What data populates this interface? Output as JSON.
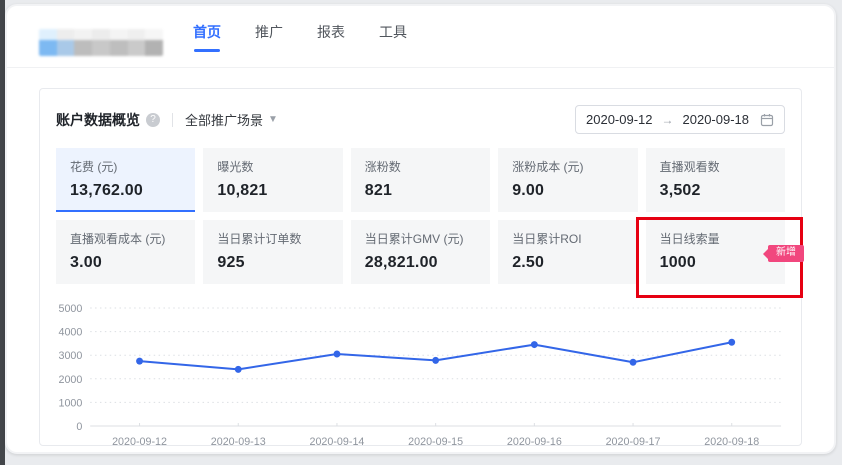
{
  "nav": {
    "tabs": [
      {
        "label": "首页",
        "active": true
      },
      {
        "label": "推广",
        "active": false
      },
      {
        "label": "报表",
        "active": false
      },
      {
        "label": "工具",
        "active": false
      }
    ]
  },
  "panel": {
    "title": "账户数据概览",
    "help_icon": "question-mark",
    "scene_filter": "全部推广场景",
    "date_start": "2020-09-12",
    "date_arrow": "→",
    "date_end": "2020-09-18"
  },
  "stats": [
    {
      "label": "花费 (元)",
      "value": "13,762.00",
      "selected": true
    },
    {
      "label": "曝光数",
      "value": "10,821"
    },
    {
      "label": "涨粉数",
      "value": "821"
    },
    {
      "label": "涨粉成本 (元)",
      "value": "9.00"
    },
    {
      "label": "直播观看数",
      "value": "3,502"
    },
    {
      "label": "直播观看成本 (元)",
      "value": "3.00"
    },
    {
      "label": "当日累计订单数",
      "value": "925"
    },
    {
      "label": "当日累计GMV (元)",
      "value": "28,821.00"
    },
    {
      "label": "当日累计ROI",
      "value": "2.50"
    },
    {
      "label": "当日线索量",
      "value": "1000",
      "badge": "新增",
      "annotated": true
    }
  ],
  "chart_data": {
    "type": "line",
    "x": [
      "2020-09-12",
      "2020-09-13",
      "2020-09-14",
      "2020-09-15",
      "2020-09-16",
      "2020-09-17",
      "2020-09-18"
    ],
    "series": [
      {
        "name": "花费",
        "values": [
          2750,
          2400,
          3050,
          2780,
          3450,
          2700,
          3550
        ]
      }
    ],
    "ylim": [
      0,
      5000
    ],
    "yticks": [
      0,
      1000,
      2000,
      3000,
      4000,
      5000
    ],
    "grid": "dotted horizontal",
    "legend": "none",
    "line_color": "#3366e8",
    "axis_color": "#dcdfe3",
    "tick_label_color": "#8f959e"
  },
  "colors": {
    "accent": "#3370ff",
    "badge_pink": "#f1477e",
    "annotation_red": "#e60012",
    "selected_card_bg": "#edf3fe",
    "card_bg": "#f5f6f7"
  }
}
